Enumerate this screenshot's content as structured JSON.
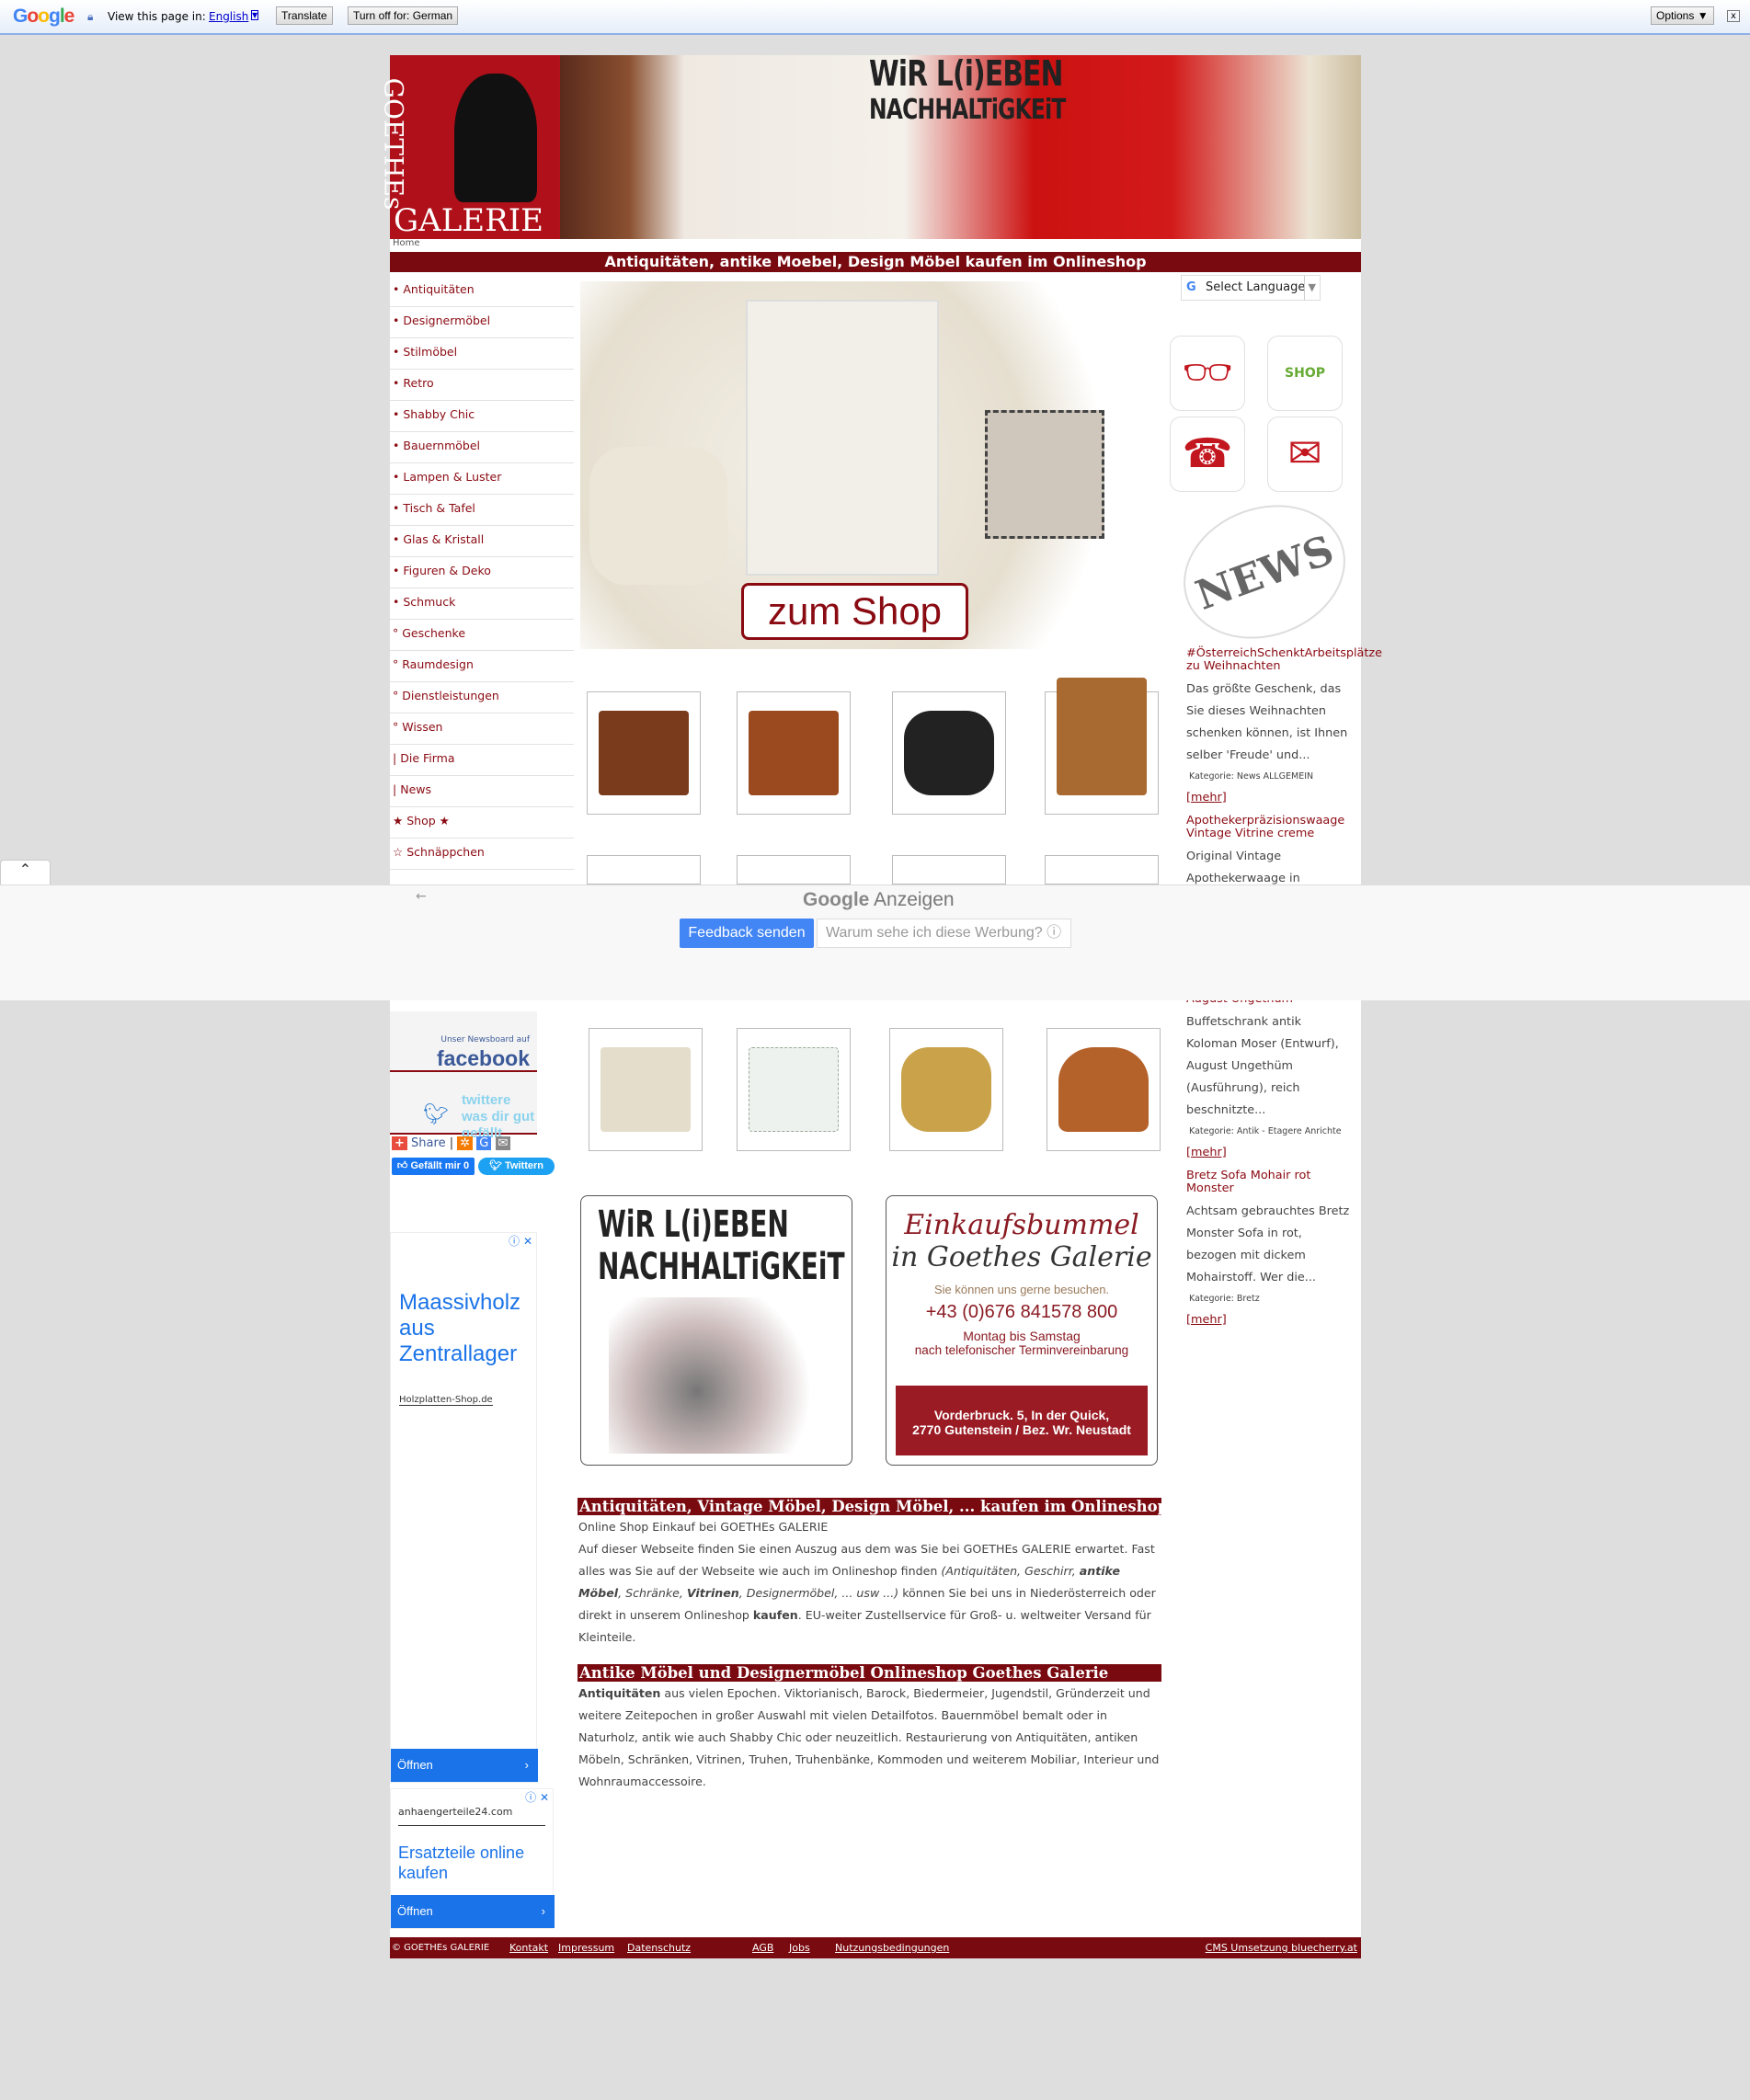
{
  "translate_bar": {
    "logo": "Google",
    "prompt": "View this page in:",
    "language": "English",
    "translate": "Translate",
    "turn_off": "Turn off for: German",
    "options": "Options ▼",
    "close": "x"
  },
  "header": {
    "logo": "GOETHEs GALERIE",
    "slogan_1": "WiR L(i)EBEN",
    "slogan_2": "NACHHALTiGKEiT",
    "breadcrumb": "Home",
    "title": "Antiquitäten, antike Moebel, Design Möbel kaufen im Onlineshop"
  },
  "nav": [
    {
      "b": "•",
      "label": "Antiquitäten"
    },
    {
      "b": "•",
      "label": "Designermöbel"
    },
    {
      "b": "•",
      "label": "Stilmöbel"
    },
    {
      "b": "•",
      "label": "Retro"
    },
    {
      "b": "•",
      "label": "Shabby Chic"
    },
    {
      "b": "•",
      "label": "Bauernmöbel"
    },
    {
      "b": "•",
      "label": "Lampen & Luster"
    },
    {
      "b": "•",
      "label": "Tisch & Tafel"
    },
    {
      "b": "•",
      "label": "Glas & Kristall"
    },
    {
      "b": "•",
      "label": "Figuren & Deko"
    },
    {
      "b": "•",
      "label": "Schmuck"
    },
    {
      "b": "°",
      "label": "Geschenke"
    },
    {
      "b": "°",
      "label": "Raumdesign"
    },
    {
      "b": "°",
      "label": "Dienstleistungen"
    },
    {
      "b": "°",
      "label": "Wissen"
    },
    {
      "b": "|",
      "label": "Die Firma"
    },
    {
      "b": "|",
      "label": "News"
    },
    {
      "b": "★",
      "label": "Shop ★"
    },
    {
      "b": "☆",
      "label": "Schnäppchen"
    }
  ],
  "hero": {
    "button": "zum Shop"
  },
  "language_select": "Select Language",
  "quick_icons": [
    "glasses-icon",
    "shop-bag-icon",
    "phone-icon",
    "mail-icon"
  ],
  "quick_shop_label": "SHOP",
  "news_graphic": "NEWS",
  "news": [
    {
      "title": "#ÖsterreichSchenktArbeitsplätze zu Weihnachten",
      "text": "Das größte Geschenk, das Sie dieses Weihnachten schenken können, ist Ihnen selber 'Freude' und...",
      "category": "Kategorie: News ALLGEMEIN",
      "more": "[mehr]"
    },
    {
      "title": "Apothekerpräzisionswaage Vintage Vitrine creme",
      "text": "Original Vintage Apothekerwaage in traumhaft"
    },
    {
      "title": "August Ungethüm",
      "text": "Buffetschrank antik Koloman Moser (Entwurf), August Ungethüm (Ausführung), reich beschnitzte...",
      "category": "Kategorie: Antik - Etagere Anrichte",
      "more": "[mehr]"
    },
    {
      "title": "Bretz Sofa Mohair rot Monster",
      "text": "Achtsam gebrauchtes Bretz Monster Sofa in rot, bezogen mit dickem Mohairstoff. Wer die...",
      "category": "Kategorie: Bretz",
      "more": "[mehr]"
    }
  ],
  "ad_overlay": {
    "brand": "Google",
    "label": "Anzeigen",
    "feedback": "Feedback senden",
    "why": "Warum sehe ich diese Werbung? ⓘ"
  },
  "social": {
    "facebook_small": "Unser Newsboard auf",
    "facebook": "facebook",
    "twitter": "twittere was dir gut gefällt",
    "share": "Share",
    "like": "Gefällt mir 0",
    "tweet": "Twittern"
  },
  "ads": [
    {
      "text": "Maassivholz aus Zentrallager",
      "source": "Holzplatten-Shop.de",
      "open": "Öffnen"
    },
    {
      "source": "anhaengerteile24.com",
      "text": "Ersatzteile online kaufen",
      "open": "Öffnen"
    }
  ],
  "promo_left": {
    "line1": "WiR L(i)EBEN",
    "line2": "NACHHALTiGKEiT"
  },
  "promo_right": {
    "script1": "Einkaufsbummel",
    "script2": "in Goethes Galerie",
    "visit": "Sie können uns gerne besuchen.",
    "phone": "+43 (0)676 841578 800",
    "days": "Montag  bis  Samstag",
    "appointment": "nach telefonischer Terminvereinbarung",
    "address1": "Vorderbruck. 5, In der Quick,",
    "address2": "2770 Gutenstein / Bez. Wr. Neustadt"
  },
  "section1": {
    "heading": "Antiquitäten, Vintage Möbel, Design Möbel, ... kaufen im Onlineshop",
    "intro": "Online Shop Einkauf bei GOETHEs GALERIE",
    "p1": "Auf dieser Webseite finden Sie einen Auszug aus dem was Sie bei GOETHEs GALERIE erwartet. Fast alles was Sie auf der Webseite wie auch im Onlineshop finden ",
    "p1_em1": "(Antiquitäten, Geschirr, ",
    "p1_strong1": "antike Möbel",
    "p1_em2": ", Schränke, ",
    "p1_strong2": "Vitrinen",
    "p1_em3": ", Designermöbel, ... usw ...)",
    "p1_b": " können Sie bei uns in Niederösterreich oder direkt in unserem Onlineshop ",
    "p1_strong3": "kaufen",
    "p1_c": ". EU-weiter Zustellservice für Groß- u. weltweiter Versand für Kleinteile."
  },
  "section2": {
    "heading": "Antike Möbel und Designermöbel Onlineshop Goethes Galerie",
    "strong": "Antiquitäten",
    "text": " aus vielen Epochen. Viktorianisch, Barock, Biedermeier, Jugendstil, Gründerzeit und weitere Zeitepochen in großer Auswahl mit vielen Detailfotos. Bauernmöbel bemalt oder in Naturholz, antik wie auch Shabby Chic oder neuzeitlich. Restaurierung von Antiquitäten, antiken Möbeln, Schränken, Vitrinen, Truhen, Truhenbänke, Kommoden und weiterem Mobiliar, Interieur und Wohnraumaccessoire."
  },
  "footer": {
    "copyright": "© GOETHEs GALERIE",
    "links": [
      "Kontakt",
      "Impressum",
      "Datenschutz",
      "AGB",
      "Jobs",
      "Nutzungsbedingungen"
    ],
    "cms": "CMS Umsetzung bluecherry.at"
  },
  "colors": {
    "brand_red": "#790a10",
    "link_red": "#8a0a12",
    "ad_blue": "#1a73e8"
  }
}
